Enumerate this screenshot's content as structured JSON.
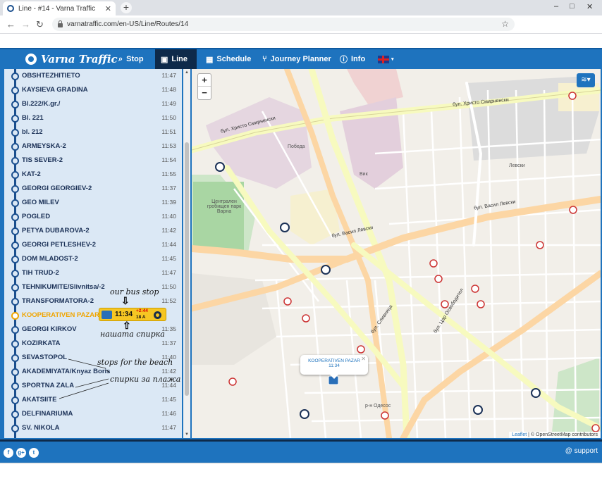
{
  "browser": {
    "tab_title": "Line - #14 - Varna Traffic",
    "tab_close": "✕",
    "new_tab": "+",
    "url": "varnatraffic.com/en-US/Line/Routes/14",
    "win_min": "–",
    "win_max": "□",
    "win_close": "✕"
  },
  "nav": {
    "logo": "Varna Traffic",
    "items": [
      {
        "label": "Stop",
        "icon": "map-search-icon"
      },
      {
        "label": "Line",
        "icon": "bus-icon"
      },
      {
        "label": "Schedule",
        "icon": "calendar-icon"
      },
      {
        "label": "Journey Planner",
        "icon": "route-icon"
      },
      {
        "label": "Info",
        "icon": "info-icon"
      }
    ],
    "language": "uk-flag-icon"
  },
  "stops": [
    {
      "name": "OBSHTEZHITIETO",
      "time": "11:47"
    },
    {
      "name": "KAYSIEVA GRADINA",
      "time": "11:48"
    },
    {
      "name": "Bl.222/K.gr./",
      "time": "11:49"
    },
    {
      "name": "Bl. 221",
      "time": "11:50"
    },
    {
      "name": "bl. 212",
      "time": "11:51"
    },
    {
      "name": "ARMEYSKA-2",
      "time": "11:53"
    },
    {
      "name": "TIS SEVER-2",
      "time": "11:54"
    },
    {
      "name": "KAT-2",
      "time": "11:55"
    },
    {
      "name": "GEORGI GEORGIEV-2",
      "time": "11:37"
    },
    {
      "name": "GEO MILEV",
      "time": "11:39"
    },
    {
      "name": "POGLED",
      "time": "11:40"
    },
    {
      "name": "PETYA DUBAROVA-2",
      "time": "11:42"
    },
    {
      "name": "GEORGI PETLESHEV-2",
      "time": "11:44"
    },
    {
      "name": "DOM MLADOST-2",
      "time": "11:45"
    },
    {
      "name": "TIH TRUD-2",
      "time": "11:47"
    },
    {
      "name": "TEHNIKUMITE/Slivnitsa/-2",
      "time": "11:50"
    },
    {
      "name": "TRANSFORMATORA-2",
      "time": "11:52"
    },
    {
      "name": "KOOPERATIVEN PAZAR",
      "time": ""
    },
    {
      "name": "GEORGI KIRKOV",
      "time": "11:35"
    },
    {
      "name": "KOZIRKATA",
      "time": "11:37"
    },
    {
      "name": "SEVASTOPOL",
      "time": "11:40"
    },
    {
      "name": "AKADEMIYATA/Knyaz Boris",
      "time": "11:42"
    },
    {
      "name": "SPORTNA ZALA",
      "time": "11:44"
    },
    {
      "name": "AKATSIITE",
      "time": "11:45"
    },
    {
      "name": "DELFINARIUMA",
      "time": "11:46"
    },
    {
      "name": "SV. NIKOLA",
      "time": "11:47"
    }
  ],
  "current_stop_index": 17,
  "bus_badge": {
    "time": "11:34",
    "delay": "+2:44",
    "plate": "18 A"
  },
  "annotations": {
    "our_bus_stop": "our bus stop",
    "nashata_spirka": "нашата спирка",
    "stops_for_beach": "stops for the beach",
    "spirki_za_plazha": "спирки за плажа"
  },
  "map": {
    "popup_name": "KOOPERATIVEN PAZAR",
    "popup_time": "11:34",
    "popup_close": "✕",
    "zoom_in": "+",
    "zoom_out": "−",
    "labels": {
      "pobeda": "Победа",
      "levski": "Левски",
      "vik": "Вик",
      "odesos": "р-н Одесос",
      "blvd_smirnenski": "бул. Христо Смирненски",
      "blvd_smirnenski2": "бул. Христо Смирненски",
      "blvd_vasil_levski": "бул. Васил Левски",
      "blvd_vasil_levski2": "бул. Васил Левски",
      "blvd_tsar_osvoboditel": "бул. Цар Освободител",
      "blvd_slivnitsa": "бул. Сливница",
      "cemetery": "Централен гробищен парк Варна"
    },
    "attribution_leaflet": "Leaflet",
    "attribution_osm": "© OpenStreetMap contributors"
  },
  "footer": {
    "support": "@ support",
    "social": [
      "f",
      "g+",
      "t"
    ]
  },
  "colors": {
    "brand": "#1e73be",
    "nav_active": "#0e2a4a",
    "current_stop": "#f0a500",
    "bus_badge": "#f6c623"
  }
}
